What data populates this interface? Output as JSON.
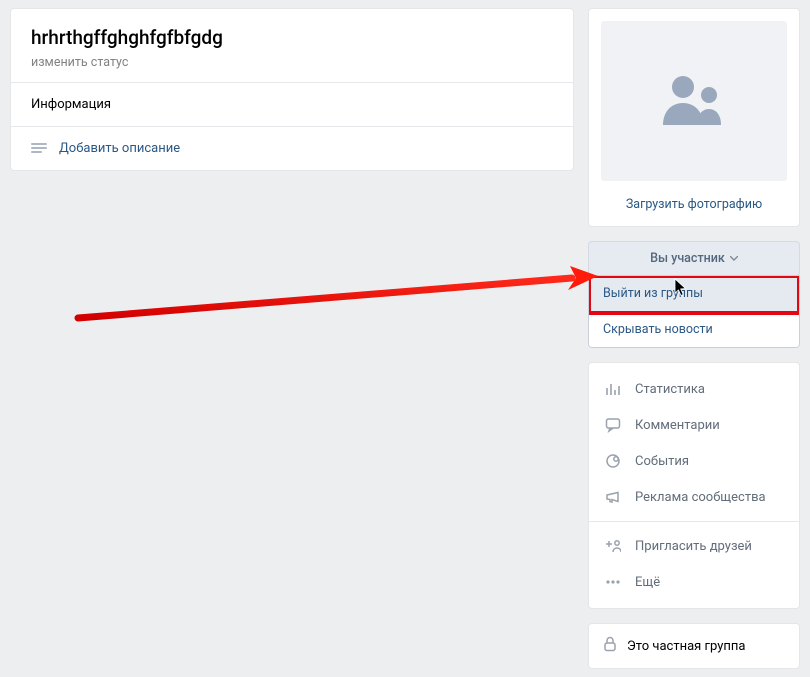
{
  "header": {
    "title": "hrhrthgffghghfgfbfgdg",
    "status_placeholder": "изменить статус",
    "info_label": "Информация",
    "add_description": "Добавить описание"
  },
  "sidebar": {
    "upload_photo": "Загрузить фотографию",
    "member_button": "Вы участник",
    "dropdown": {
      "leave": "Выйти из группы",
      "hide_news": "Скрывать новости"
    },
    "menu": {
      "stats": "Статистика",
      "comments": "Комментарии",
      "events": "События",
      "ads": "Реклама сообщества",
      "invite": "Пригласить друзей",
      "more": "Ещё"
    },
    "private_label": "Это частная группа"
  }
}
